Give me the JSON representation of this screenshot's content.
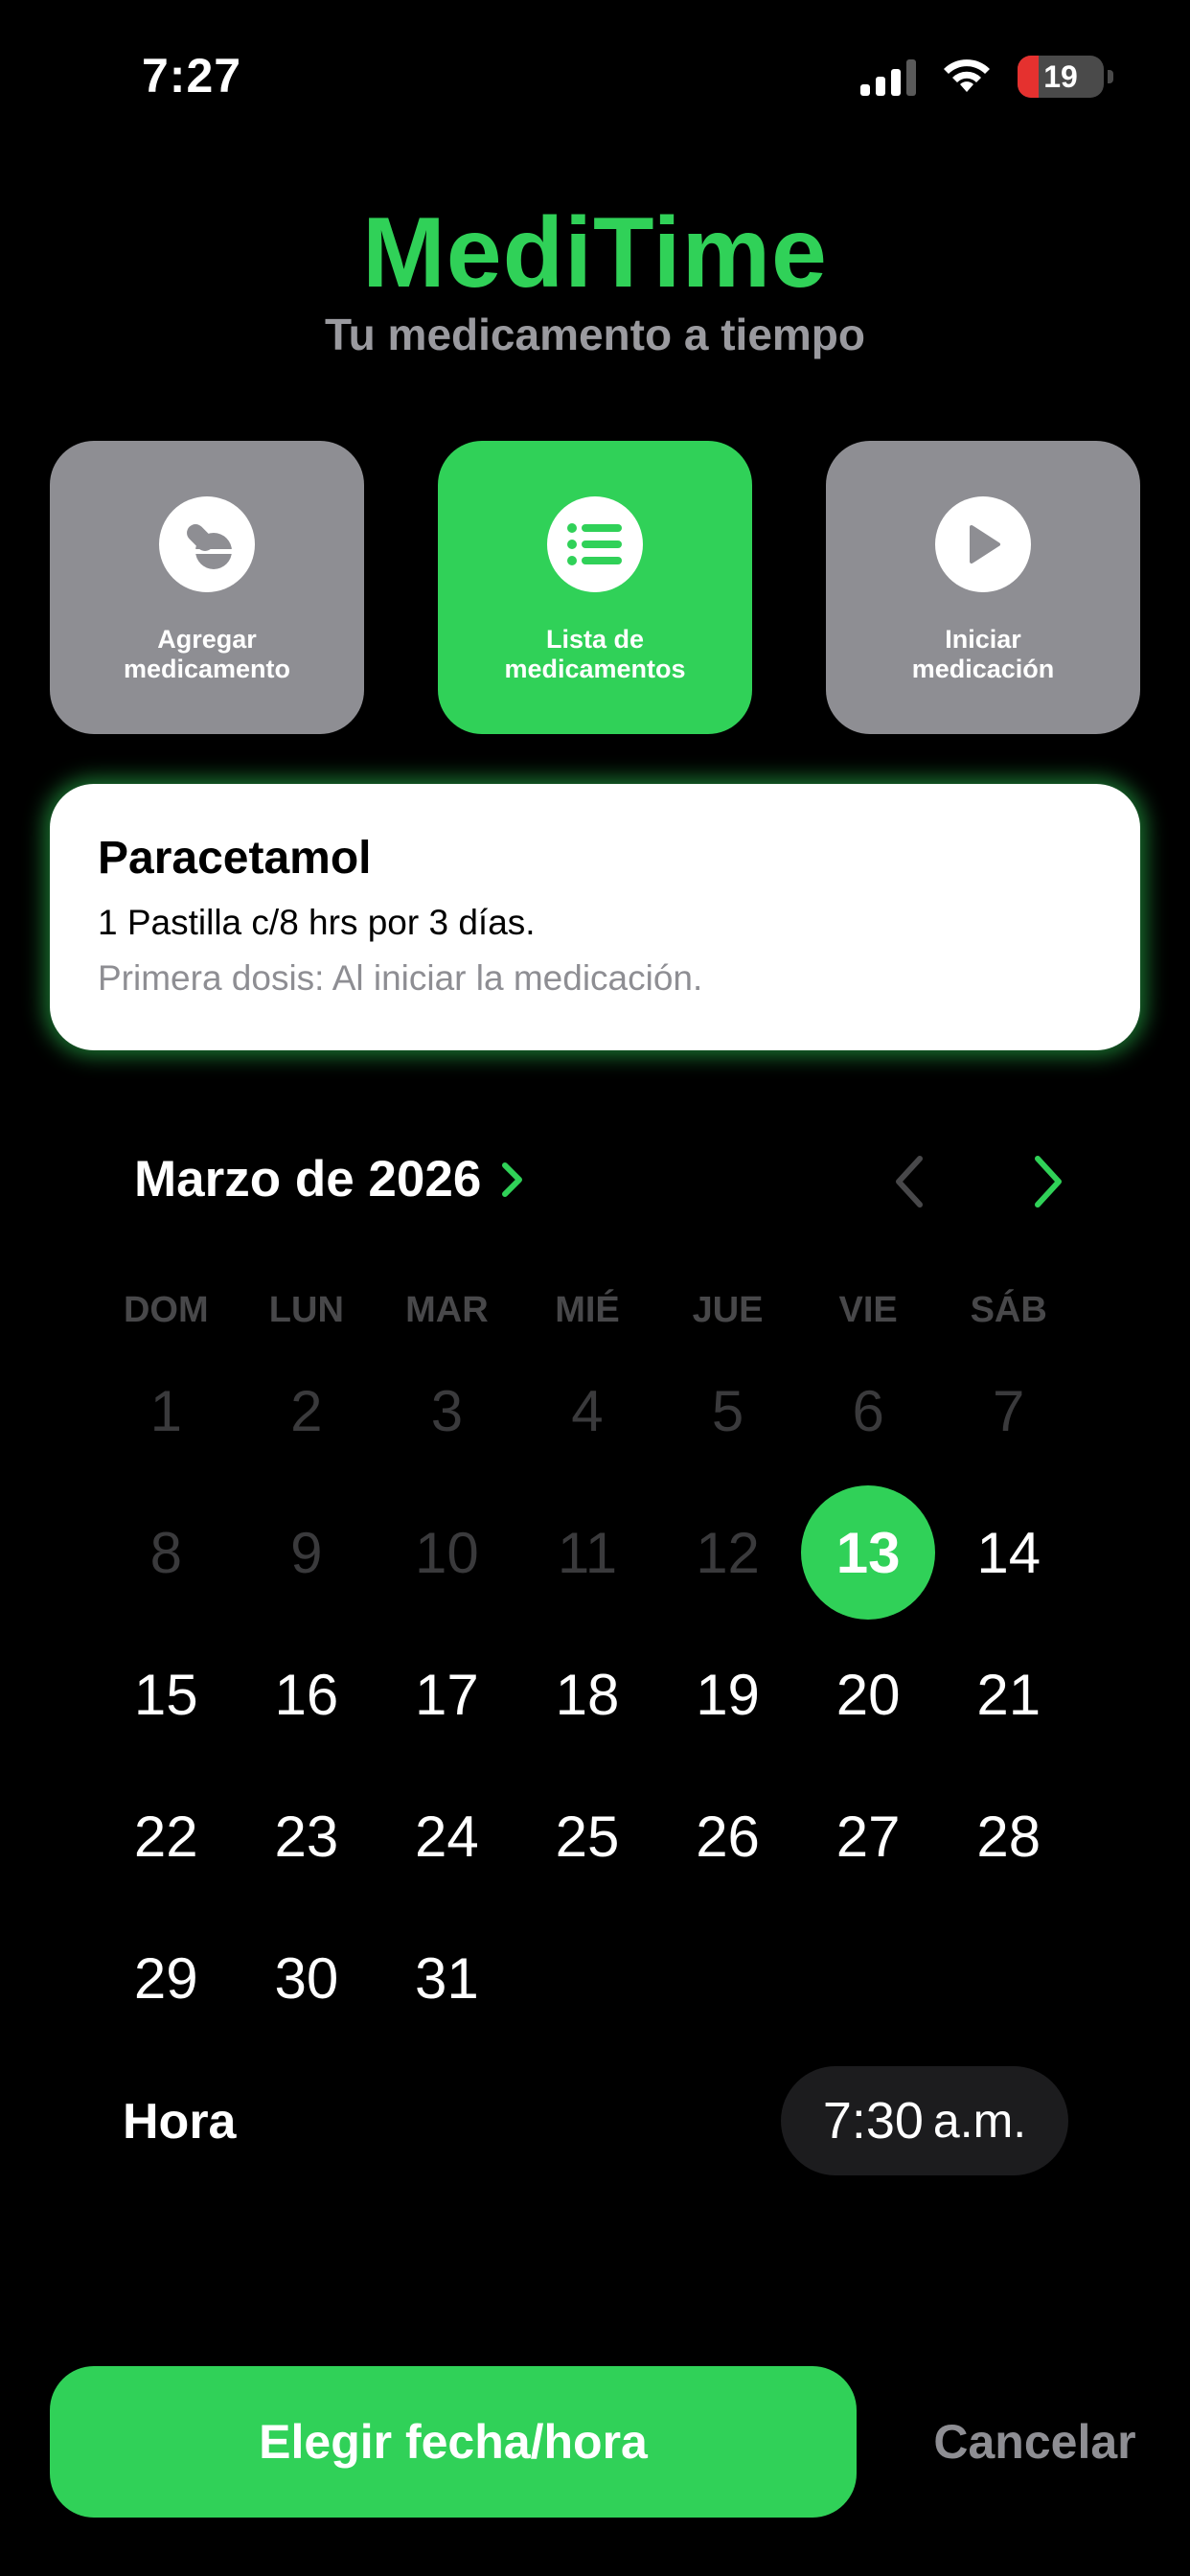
{
  "status_bar": {
    "time": "7:27",
    "battery": "19"
  },
  "header": {
    "title": "MediTime",
    "subtitle": "Tu medicamento a tiempo"
  },
  "actions": [
    {
      "label": "Agregar\nmedicamento",
      "icon": "pill-icon",
      "active": false
    },
    {
      "label": "Lista de\nmedicamentos",
      "icon": "list-icon",
      "active": true
    },
    {
      "label": "Iniciar\nmedicación",
      "icon": "play-icon",
      "active": false
    }
  ],
  "medication": {
    "name": "Paracetamol",
    "dose": "1 Pastilla c/8 hrs por 3 días.",
    "first_dose": "Primera dosis: Al iniciar la medicación."
  },
  "calendar": {
    "month_label": "Marzo de 2026",
    "weekdays": [
      "DOM",
      "LUN",
      "MAR",
      "MIÉ",
      "JUE",
      "VIE",
      "SÁB"
    ],
    "first_weekday_index": 0,
    "days_in_month": 31,
    "selected_day": 13,
    "first_available_day": 13
  },
  "time_picker": {
    "label": "Hora",
    "time": "7:30",
    "ampm": "a.m."
  },
  "buttons": {
    "primary": "Elegir fecha/hora",
    "cancel": "Cancelar"
  },
  "colors": {
    "accent": "#30d158",
    "card_inactive": "#8e8e93",
    "past_day": "#3a3a3c"
  }
}
